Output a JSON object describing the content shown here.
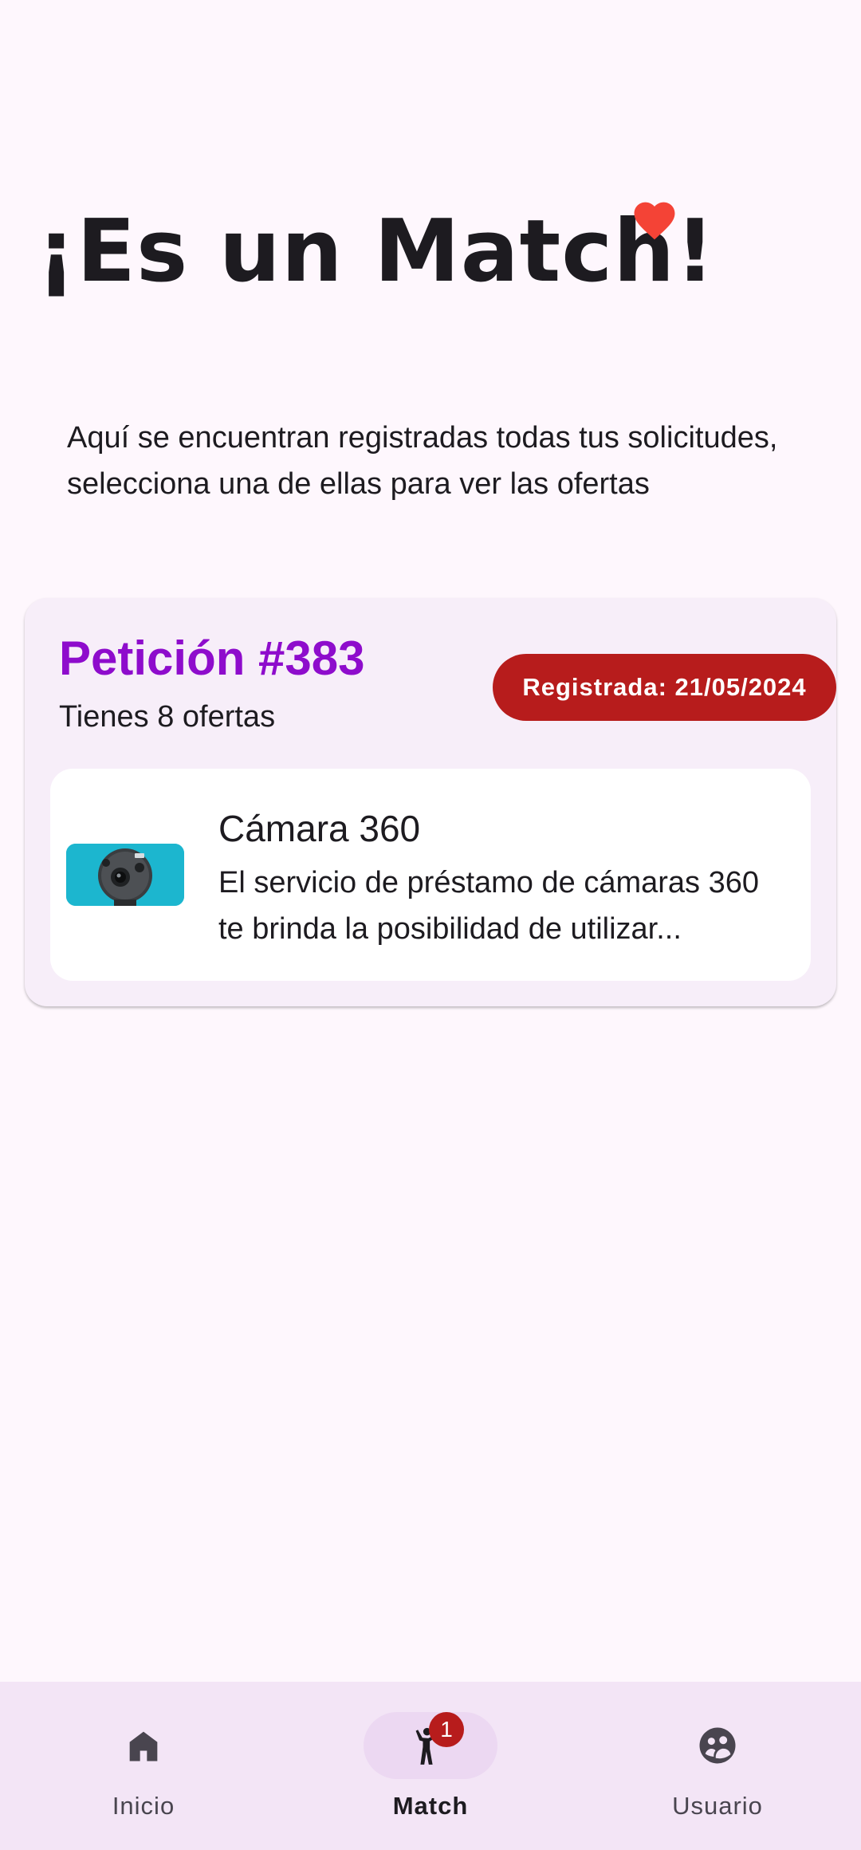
{
  "header": {
    "title": "¡Es un Match!",
    "heart_icon": "heart-icon",
    "heart_color": "#f44336"
  },
  "description": "Aquí se encuentran registradas todas tus solicitudes, selecciona una de ellas para ver las ofertas",
  "request": {
    "title": "Petición #383",
    "offers_count": "Tienes 8 ofertas",
    "date_badge": "Registrada: 21/05/2024",
    "title_color": "#8e0ccc",
    "badge_color": "#b71c1c",
    "offers": [
      {
        "name": "Cámara 360",
        "description": "El servicio de préstamo de cámaras 360 te brinda la posibilidad de utilizar...",
        "image": "camera-360-thumbnail"
      }
    ]
  },
  "bottom_nav": {
    "items": [
      {
        "label": "Inicio",
        "icon": "home-icon"
      },
      {
        "label": "Match",
        "icon": "person-waving-icon",
        "badge": "1",
        "active": true
      },
      {
        "label": "Usuario",
        "icon": "group-icon"
      }
    ]
  }
}
